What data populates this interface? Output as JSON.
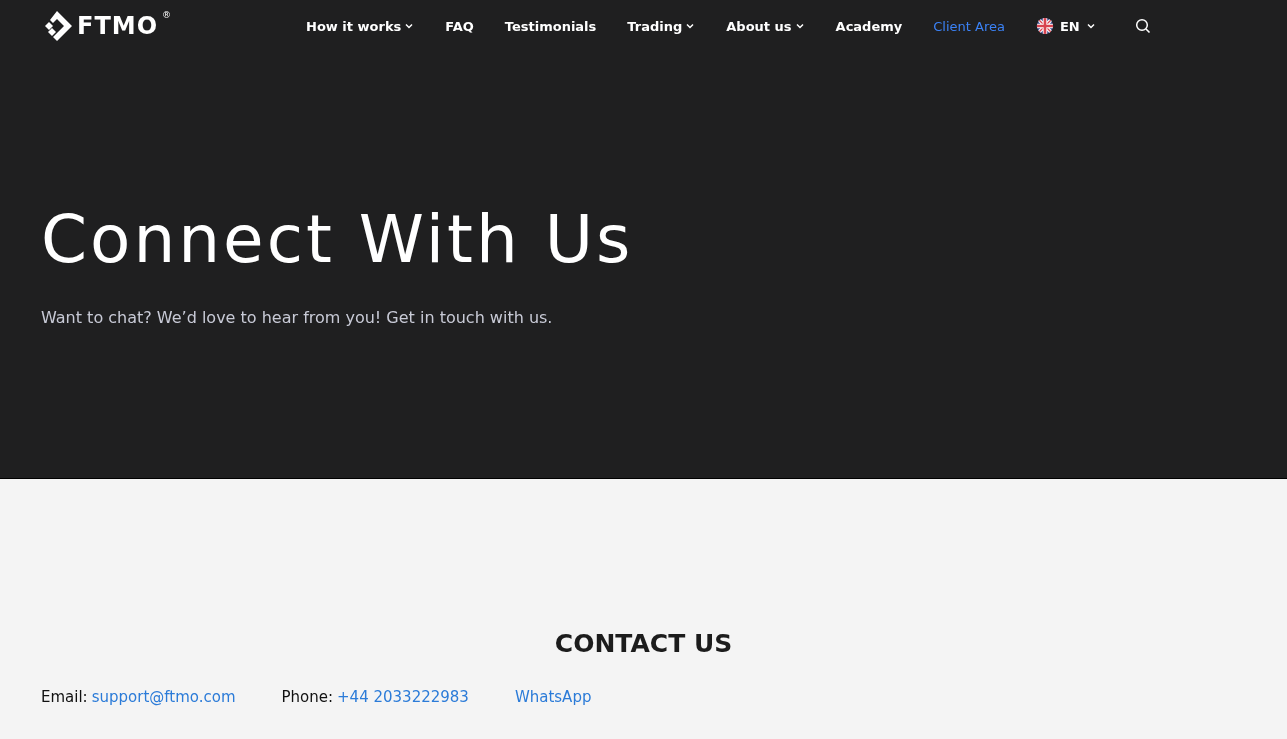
{
  "header": {
    "logo": {
      "text": "FTMO",
      "mark": "®"
    },
    "nav": [
      {
        "label": "How it works",
        "dropdown": true,
        "accent": false
      },
      {
        "label": "FAQ",
        "dropdown": false,
        "accent": false
      },
      {
        "label": "Testimonials",
        "dropdown": false,
        "accent": false
      },
      {
        "label": "Trading",
        "dropdown": true,
        "accent": false
      },
      {
        "label": "About us",
        "dropdown": true,
        "accent": false
      },
      {
        "label": "Academy",
        "dropdown": false,
        "accent": false
      },
      {
        "label": "Client Area",
        "dropdown": false,
        "accent": true
      }
    ],
    "language": {
      "label": "EN"
    }
  },
  "hero": {
    "title": "Connect With Us",
    "subtitle": "Want to chat? We’d love to hear from you! Get in touch with us."
  },
  "contact": {
    "heading": "CONTACT US",
    "items": [
      {
        "label": "Email:",
        "value": "support@ftmo.com"
      },
      {
        "label": "Phone:",
        "value": "+44 2033222983"
      },
      {
        "value": "WhatsApp"
      }
    ]
  }
}
